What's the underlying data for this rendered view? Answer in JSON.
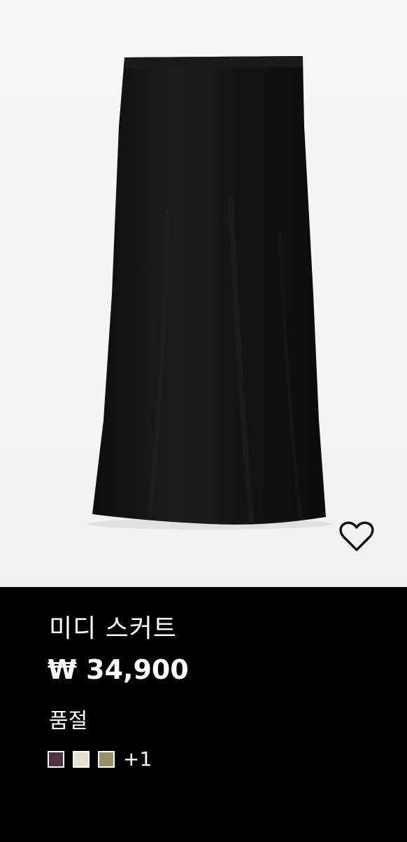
{
  "product": {
    "name": "미디 스커트",
    "price": "₩ 34,900",
    "stock_status": "품절",
    "more_colors": "+1",
    "swatches": [
      {
        "name": "dark-plum",
        "color": "#4e3340"
      },
      {
        "name": "cream",
        "color": "#e7e0d2"
      },
      {
        "name": "khaki",
        "color": "#9a8e66"
      }
    ],
    "image_icon": "skirt-product-photo",
    "wishlist_icon": "heart-outline-icon"
  },
  "colors": {
    "background": "#000000",
    "image_bg": "#f5f5f5",
    "text": "#ffffff",
    "skirt": "#161616"
  }
}
